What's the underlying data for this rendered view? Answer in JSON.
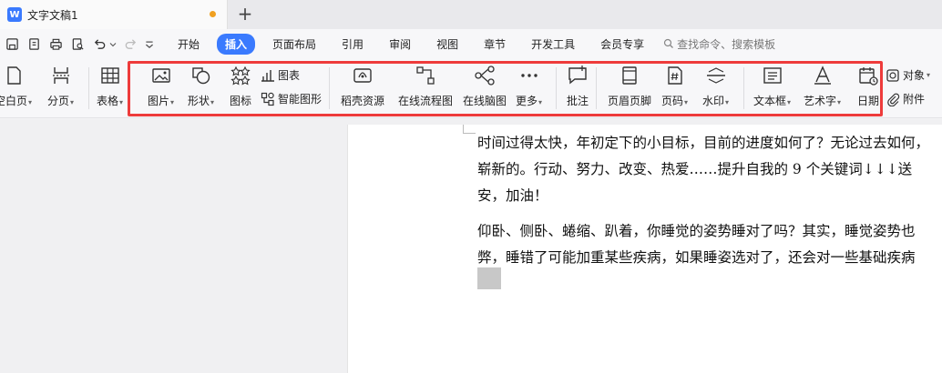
{
  "titlebar": {
    "app_logo": "W",
    "doc_title": "文字文稿1",
    "new_tab": "+"
  },
  "menubar": {
    "tabs": [
      "开始",
      "插入",
      "页面布局",
      "引用",
      "审阅",
      "视图",
      "章节",
      "开发工具",
      "会员专享"
    ],
    "active_tab": "插入",
    "search_label": "查找命令、搜索模板"
  },
  "ribbon": {
    "blank_page": "空白页",
    "page_break": "分页",
    "table": "表格",
    "picture": "图片",
    "shape": "形状",
    "icon": "图标",
    "chart": "图表",
    "smart_art": "智能图形",
    "docer_resources": "稻壳资源",
    "online_flowchart": "在线流程图",
    "online_mindmap": "在线脑图",
    "more": "更多",
    "comment": "批注",
    "header_footer": "页眉页脚",
    "page_number": "页码",
    "watermark": "水印",
    "text_box": "文本框",
    "word_art": "艺术字",
    "date": "日期",
    "object": "对象",
    "attachment": "附件"
  },
  "document": {
    "paragraphs": [
      "时间过得太快，年初定下的小目标，目前的进度如何了？无论过去如何，",
      "崭新的。行动、努力、改变、热爱……提升自我的 9 个关键词↓↓↓送",
      "安，加油！",
      "仰卧、侧卧、蜷缩、趴着，你睡觉的姿势睡对了吗？其实，睡觉姿势也",
      "弊，睡错了可能加重某些疾病，如果睡姿选对了，还会对一些基础疾病"
    ]
  },
  "colors": {
    "accent": "#3a7afe",
    "highlight_border": "#ee3b3b",
    "unsaved": "#f0a020"
  }
}
